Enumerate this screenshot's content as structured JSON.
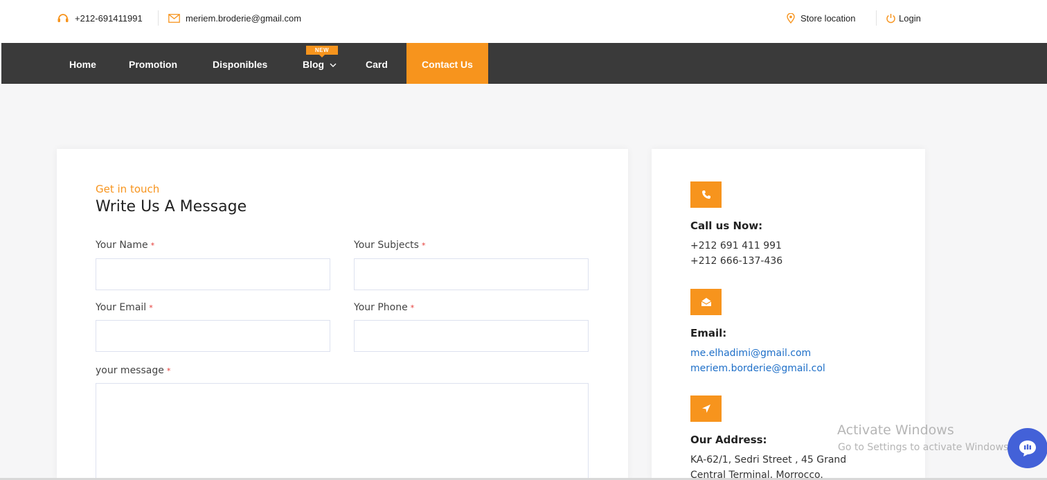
{
  "topbar": {
    "phone": "+212-691411991",
    "email": "meriem.broderie@gmail.com",
    "store_location": "Store location",
    "login": "Login"
  },
  "nav": {
    "items": [
      {
        "label": "Home"
      },
      {
        "label": "Promotion"
      },
      {
        "label": "Disponibles"
      },
      {
        "label": "Blog"
      },
      {
        "label": "Card"
      },
      {
        "label": "Contact Us"
      }
    ],
    "badge": "NEW"
  },
  "form": {
    "eyebrow": "Get in touch",
    "heading": "Write Us A Message",
    "name_label": "Your Name",
    "subjects_label": "Your Subjects",
    "email_label": "Your Email",
    "phone_label": "Your Phone",
    "message_label": "your message",
    "required_mark": "*"
  },
  "contact": {
    "call_title": "Call us Now:",
    "phone1": "+212 691 411 991",
    "phone2": "+212 666-137-436",
    "email_title": "Email:",
    "email1": "me.elhadimi@gmail.com",
    "email2": "meriem.borderie@gmail.col",
    "address_title": "Our Address:",
    "address_line1": "KA-62/1, Sedri Street , 45 Grand",
    "address_line2": "Central Terminal, Morrocco."
  },
  "watermark": {
    "line1": "Activate Windows",
    "line2": "Go to Settings to activate Windows."
  },
  "colors": {
    "accent": "#f7941d",
    "nav_bg": "#3a3a3a",
    "link": "#1e6fc8",
    "chat": "#4361d8"
  }
}
